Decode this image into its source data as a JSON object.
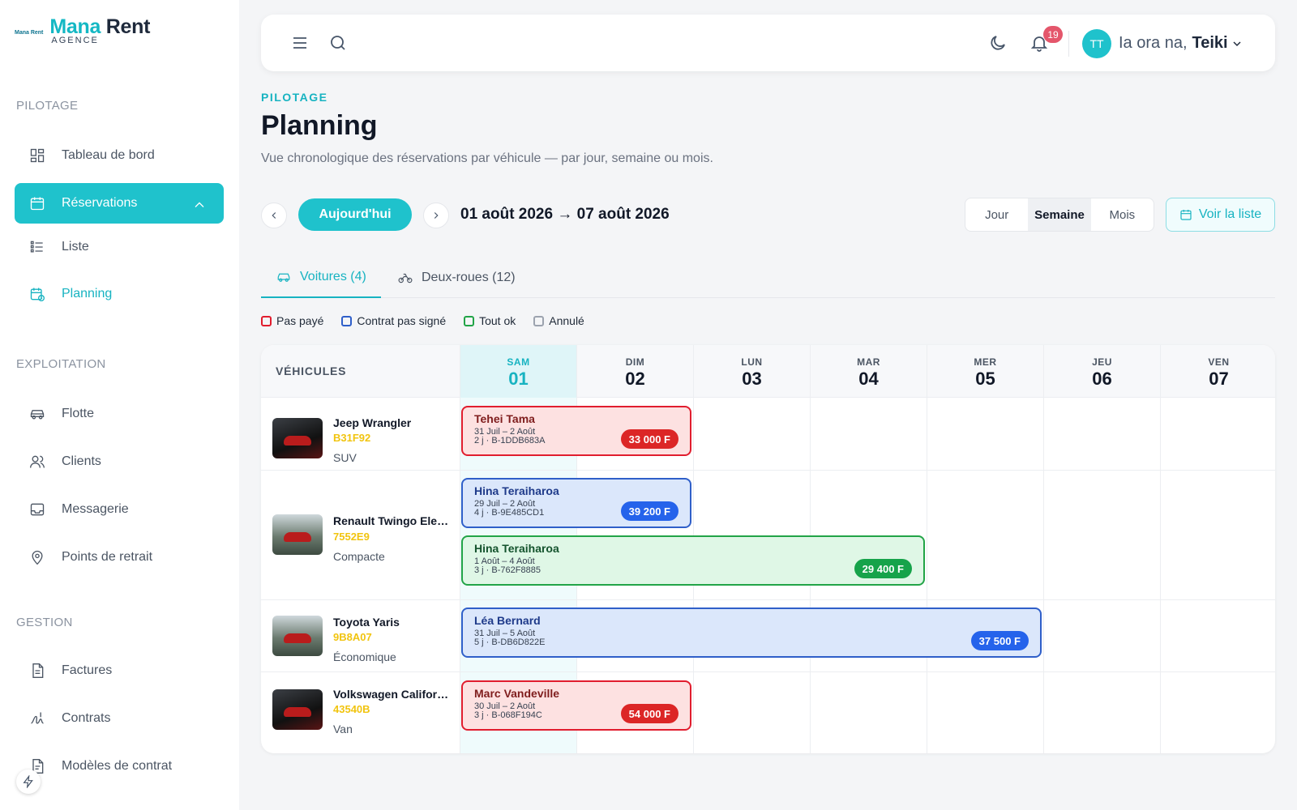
{
  "brand": {
    "small": "Mana Rent",
    "name_part1": "Mana",
    "name_part2": " Rent",
    "sub": "AGENCE"
  },
  "sidebar": {
    "sections": [
      {
        "title": "PILOTAGE"
      },
      {
        "title": "EXPLOITATION"
      },
      {
        "title": "GESTION"
      }
    ],
    "items": {
      "dashboard": "Tableau de bord",
      "reservations": "Réservations",
      "liste": "Liste",
      "planning": "Planning",
      "flotte": "Flotte",
      "clients": "Clients",
      "messagerie": "Messagerie",
      "points": "Points de retrait",
      "factures": "Factures",
      "contrats": "Contrats",
      "modeles": "Modèles de contrat"
    }
  },
  "topbar": {
    "notifications": "19",
    "avatar": "TT",
    "greeting": "Ia ora na,",
    "user": "Teiki"
  },
  "header": {
    "eyebrow": "PILOTAGE",
    "title": "Planning",
    "description": "Vue chronologique des réservations par véhicule — par jour, semaine ou mois."
  },
  "controls": {
    "today": "Aujourd'hui",
    "range": "01 août 2026 → 07 août 2026",
    "views": [
      "Jour",
      "Semaine",
      "Mois"
    ],
    "active_view": "Semaine",
    "list": "Voir la liste"
  },
  "tabs": [
    {
      "label": "Voitures (4)",
      "active": true
    },
    {
      "label": "Deux-roues (12)",
      "active": false
    }
  ],
  "legend": [
    {
      "label": "Pas payé",
      "color": "#e11d2e"
    },
    {
      "label": "Contrat pas signé",
      "color": "#2f5fc9"
    },
    {
      "label": "Tout ok",
      "color": "#22a447"
    },
    {
      "label": "Annulé",
      "color": "#9ca3af"
    }
  ],
  "grid": {
    "vehicles_header": "VÉHICULES",
    "days": [
      {
        "dow": "SAM",
        "num": "01",
        "today": true
      },
      {
        "dow": "DIM",
        "num": "02"
      },
      {
        "dow": "LUN",
        "num": "03"
      },
      {
        "dow": "MAR",
        "num": "04"
      },
      {
        "dow": "MER",
        "num": "05"
      },
      {
        "dow": "JEU",
        "num": "06"
      },
      {
        "dow": "VEN",
        "num": "07"
      }
    ],
    "vehicles": [
      {
        "name": "Jeep Wrangler",
        "plate": "B31F92",
        "type": "SUV"
      },
      {
        "name": "Renault Twingo Elec…",
        "plate": "7552E9",
        "type": "Compacte"
      },
      {
        "name": "Toyota Yaris",
        "plate": "9B8A07",
        "type": "Économique"
      },
      {
        "name": "Volkswagen Califor…",
        "plate": "43540B",
        "type": "Van"
      }
    ],
    "bookings": [
      {
        "client": "Tehei Tama",
        "dates": "31 Juil – 2 Août",
        "ref": "2 j · B-1DDB683A",
        "price": "33 000 F",
        "status": "red"
      },
      {
        "client": "Hina Teraiharoa",
        "dates": "29 Juil – 2 Août",
        "ref": "4 j · B-9E485CD1",
        "price": "39 200 F",
        "status": "blue"
      },
      {
        "client": "Hina Teraiharoa",
        "dates": "1 Août – 4 Août",
        "ref": "3 j · B-762F8885",
        "price": "29 400 F",
        "status": "green"
      },
      {
        "client": "Léa Bernard",
        "dates": "31 Juil – 5 Août",
        "ref": "5 j · B-DB6D822E",
        "price": "37 500 F",
        "status": "blue"
      },
      {
        "client": "Marc Vandeville",
        "dates": "30 Juil – 2 Août",
        "ref": "3 j · B-068F194C",
        "price": "54 000 F",
        "status": "red"
      }
    ]
  }
}
